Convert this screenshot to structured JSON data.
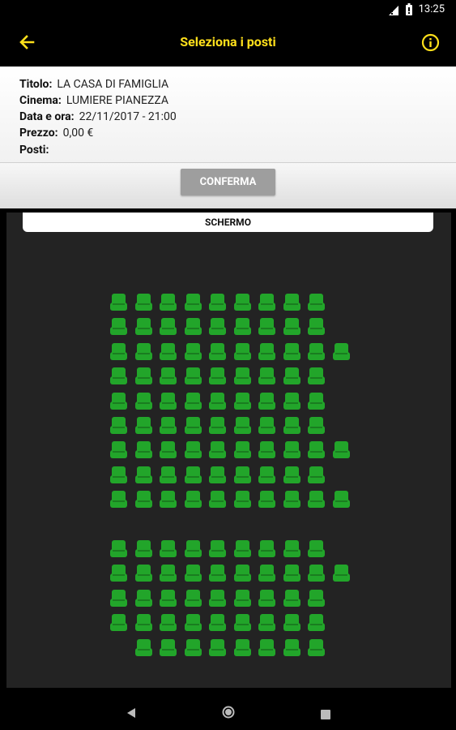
{
  "status_bar": {
    "time": "13:25"
  },
  "app_bar": {
    "title": "Seleziona i posti"
  },
  "details": {
    "title_label": "Titolo:",
    "title_value": "LA CASA DI FAMIGLIA",
    "cinema_label": "Cinema:",
    "cinema_value": "LUMIERE PIANEZZA",
    "datetime_label": "Data e ora:",
    "datetime_value": "22/11/2017 - 21:00",
    "price_label": "Prezzo:",
    "price_value": "0,00 €",
    "seats_label": "Posti:",
    "seats_value": ""
  },
  "confirm_label": "CONFERMA",
  "screen_label": "SCHERMO",
  "colors": {
    "accent": "#ffe01b",
    "seat_available": "#22a52a",
    "hall_background": "#232323"
  },
  "icons": {
    "back": "arrow-left-icon",
    "info": "info-circle-icon",
    "seat": "seat-icon"
  },
  "seat_map": {
    "rows": [
      {
        "seats": [
          1,
          2,
          3,
          4,
          5,
          6,
          7,
          8,
          9
        ]
      },
      {
        "seats": [
          1,
          2,
          3,
          4,
          5,
          6,
          7,
          8,
          9
        ]
      },
      {
        "seats": [
          1,
          2,
          3,
          4,
          5,
          6,
          7,
          8,
          9,
          10
        ]
      },
      {
        "seats": [
          1,
          2,
          3,
          4,
          5,
          6,
          7,
          8,
          9
        ]
      },
      {
        "seats": [
          1,
          2,
          3,
          4,
          5,
          6,
          7,
          8,
          9
        ]
      },
      {
        "seats": [
          1,
          2,
          3,
          4,
          5,
          6,
          7,
          8,
          9
        ]
      },
      {
        "seats": [
          1,
          2,
          3,
          4,
          5,
          6,
          7,
          8,
          9,
          10
        ]
      },
      {
        "seats": [
          1,
          2,
          3,
          4,
          5,
          6,
          7,
          8,
          9
        ]
      },
      {
        "seats": [
          1,
          2,
          3,
          4,
          5,
          6,
          7,
          8,
          9,
          10
        ]
      },
      {
        "seats": []
      },
      {
        "seats": [
          1,
          2,
          3,
          4,
          5,
          6,
          7,
          8,
          9
        ]
      },
      {
        "seats": [
          1,
          2,
          3,
          4,
          5,
          6,
          7,
          8,
          9,
          10
        ]
      },
      {
        "seats": [
          1,
          2,
          3,
          4,
          5,
          6,
          7,
          8,
          9
        ]
      },
      {
        "seats": [
          1,
          2,
          3,
          4,
          5,
          6,
          7,
          8,
          9
        ]
      },
      {
        "seats": [
          2,
          3,
          4,
          5,
          6,
          7,
          8,
          9
        ]
      }
    ]
  }
}
